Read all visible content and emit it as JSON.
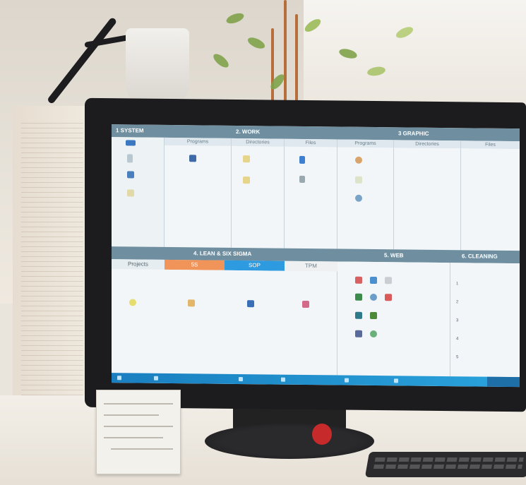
{
  "desktop": {
    "sections": {
      "system": {
        "title": "1 SYSTEM"
      },
      "work": {
        "title": "2. WORK",
        "columns": [
          "Programs",
          "Directories",
          "Files"
        ]
      },
      "graphic": {
        "title": "3 GRAPHIC",
        "columns": [
          "Programs",
          "Directories",
          "Files"
        ]
      },
      "lean": {
        "title": "4. LEAN & SIX SIGMA",
        "tabs": [
          "Projects",
          "5S",
          "SOP",
          "TPM"
        ]
      },
      "web": {
        "title": "5. WEB"
      },
      "cleaning": {
        "title": "6. CLEANING",
        "numbers": [
          "1",
          "2",
          "3",
          "4",
          "5"
        ]
      }
    },
    "colors": {
      "header": "#6f8fa0",
      "tab_5s": "#f0945a",
      "tab_sop": "#2e9be0",
      "taskbar": "#1a7fc0"
    }
  }
}
